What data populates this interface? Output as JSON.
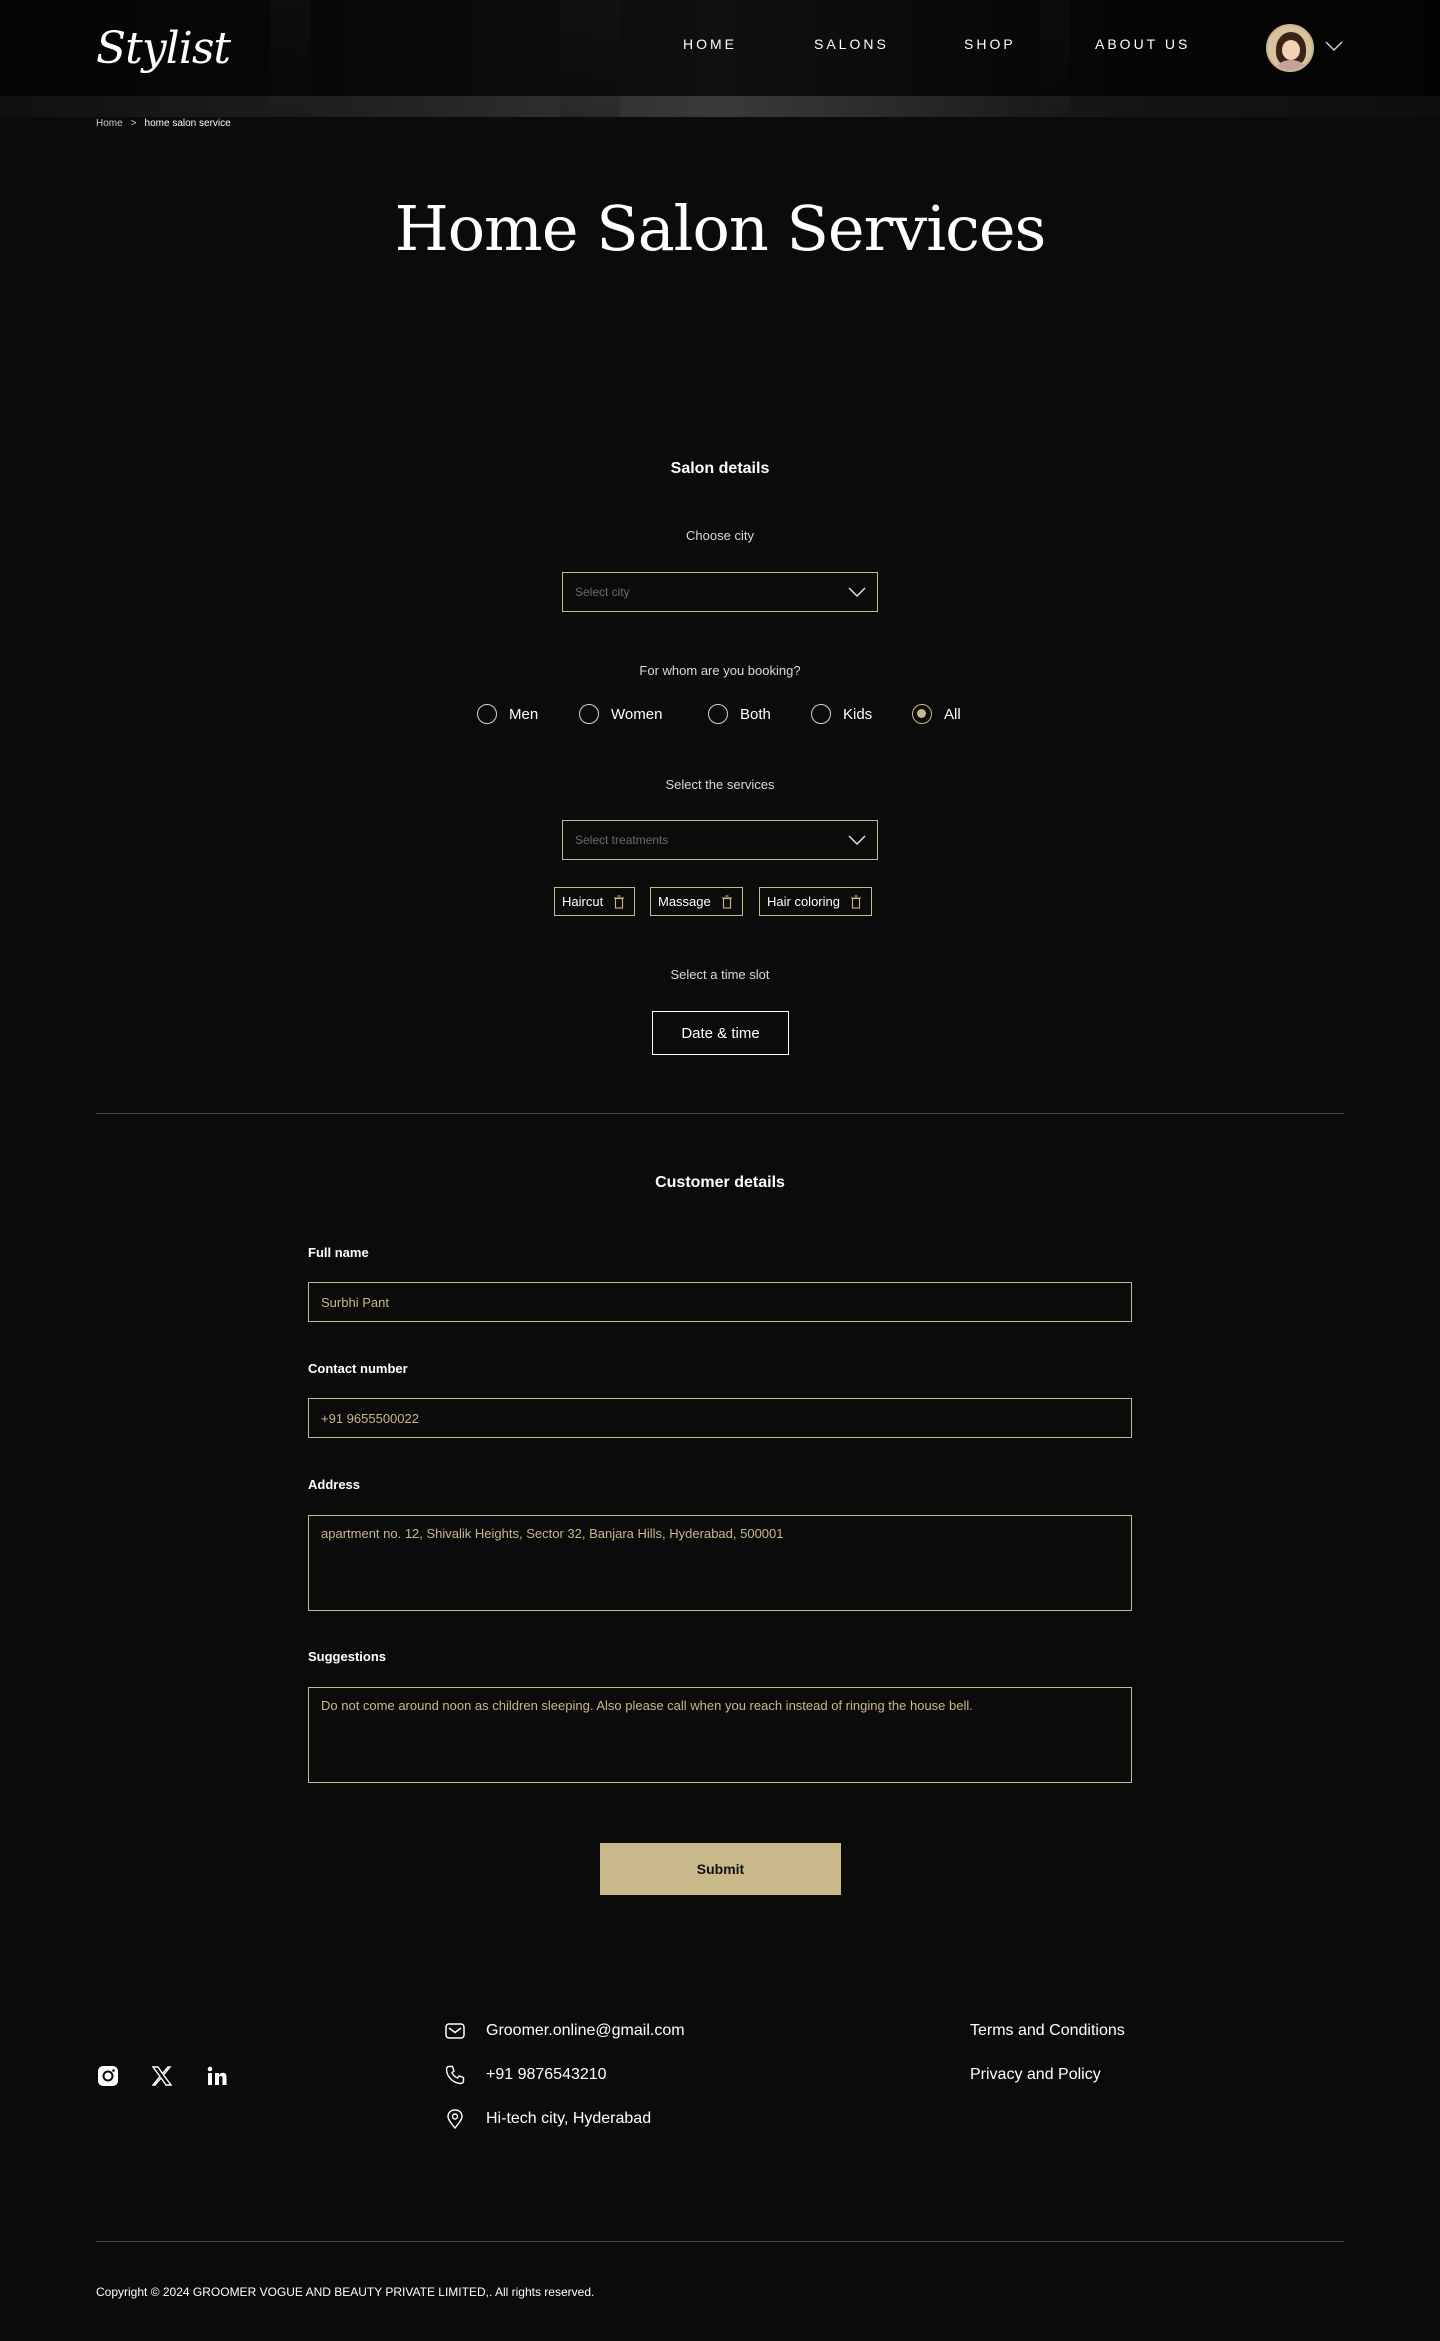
{
  "header": {
    "logo_text": "Stylist",
    "nav": [
      "HOME",
      "SALONS",
      "SHOP",
      "ABOUT US"
    ]
  },
  "breadcrumb": {
    "home": "Home",
    "separator": ">",
    "current": "home salon service"
  },
  "page_title": "Home Salon Services",
  "salon_details": {
    "title": "Salon details",
    "city_caption": "Choose city",
    "city_placeholder": "Select city",
    "booking_caption": "For whom are you booking?",
    "booking_options": [
      "Men",
      "Women",
      "Both",
      "Kids",
      "All"
    ],
    "booking_selected": "All",
    "services_caption": "Select the services",
    "services_placeholder": "Select treatments",
    "selected_services": [
      "Haircut",
      "Massage",
      "Hair coloring"
    ],
    "timeslot_caption": "Select a time slot",
    "timeslot_button": "Date & time"
  },
  "customer_details": {
    "title": "Customer details",
    "full_name_label": "Full name",
    "full_name_value": "Surbhi Pant",
    "contact_label": "Contact number",
    "contact_value": "+91 9655500022",
    "address_label": "Address",
    "address_value": "apartment no. 12, Shivalik Heights, Sector 32, Banjara Hills, Hyderabad, 500001",
    "suggestions_label": "Suggestions",
    "suggestions_value": "Do not come around noon as children sleeping. Also please call when you reach instead of ringing the house bell.",
    "submit_label": "Submit"
  },
  "footer": {
    "social_icons": [
      "instagram-icon",
      "x-twitter-icon",
      "linkedin-icon"
    ],
    "email": "Groomer.online@gmail.com",
    "phone": "+91 9876543210",
    "location": "Hi-tech city, Hyderabad",
    "links": [
      "Terms and Conditions",
      "Privacy and Policy"
    ],
    "copyright": "Copyright  ©  2024 GROOMER VOGUE AND BEAUTY PRIVATE LIMITED,. All rights reserved."
  },
  "colors": {
    "background": "#0b0b0b",
    "accent": "#c8b88a",
    "text": "#ffffff"
  }
}
